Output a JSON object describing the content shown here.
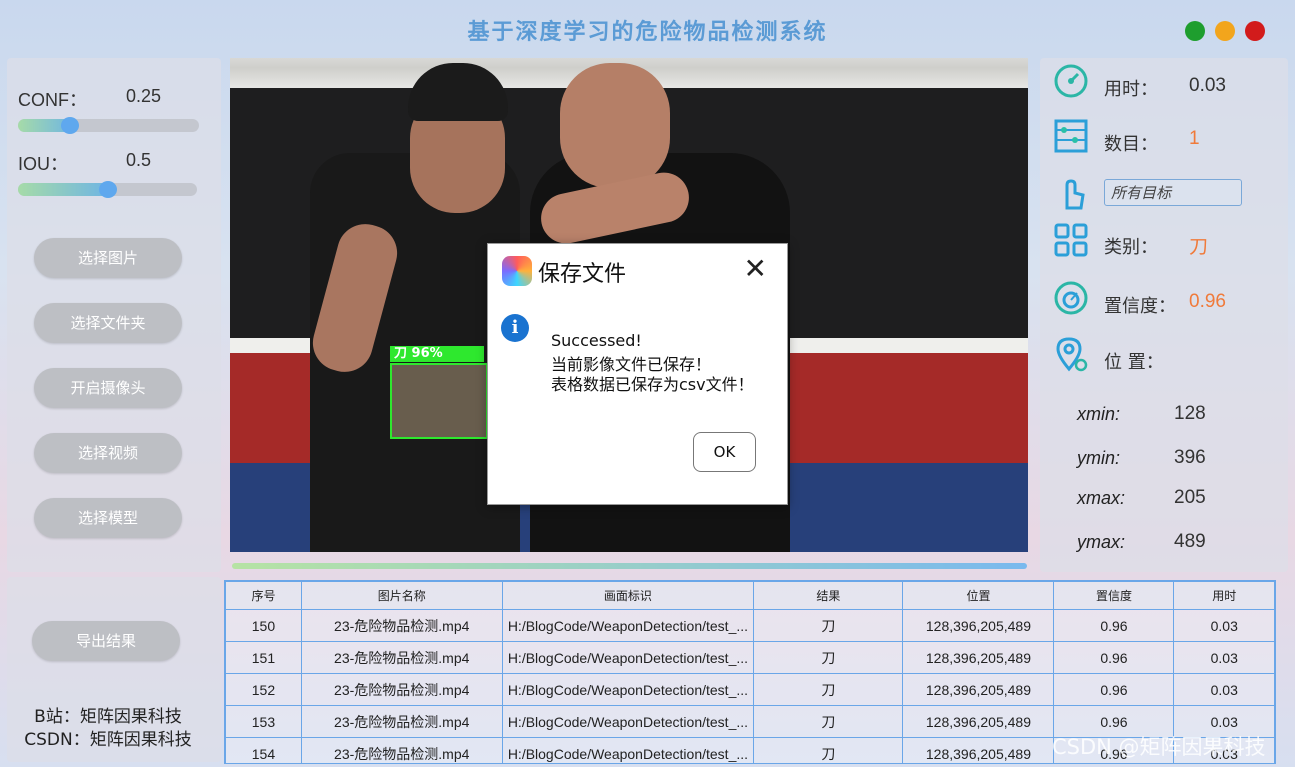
{
  "app": {
    "title": "基于深度学习的危险物品检测系统"
  },
  "window_controls": {
    "colors": [
      "#1e9e2e",
      "#f2a51c",
      "#d21b1b"
    ]
  },
  "controls": {
    "conf_label": "CONF：",
    "conf_value": "0.25",
    "conf_fraction": 0.25,
    "iou_label": "IOU：",
    "iou_value": "0.5",
    "iou_fraction": 0.5,
    "buttons": [
      "选择图片",
      "选择文件夹",
      "开启摄像头",
      "选择视频",
      "选择模型"
    ],
    "export_button": "导出结果",
    "credits": [
      "B站：矩阵因果科技",
      "CSDN：矩阵因果科技"
    ]
  },
  "video": {
    "detection_label": "刀  96%"
  },
  "dialog": {
    "title": "保存文件",
    "close": "✕",
    "info_icon": "i",
    "lines": [
      "Successed!",
      "当前影像文件已保存！",
      "表格数据已保存为csv文件！"
    ],
    "ok_label": "OK"
  },
  "stats": {
    "time_label": "用时：",
    "time_value": "0.03",
    "count_label": "数目：",
    "count_value": "1",
    "target_select": "所有目标",
    "class_label": "类别：",
    "class_value": "刀",
    "conf_label": "置信度：",
    "conf_value": "0.96",
    "position_label": "位 置：",
    "xmin_label": "xmin:",
    "xmin": "128",
    "ymin_label": "ymin:",
    "ymin": "396",
    "xmax_label": "xmax:",
    "xmax": "205",
    "ymax_label": "ymax:",
    "ymax": "489"
  },
  "table": {
    "headers": [
      "序号",
      "图片名称",
      "画面标识",
      "结果",
      "位置",
      "置信度",
      "用时"
    ],
    "rows": [
      [
        "150",
        "23-危险物品检测.mp4",
        "H:/BlogCode/WeaponDetection/test_...",
        "刀",
        "128,396,205,489",
        "0.96",
        "0.03"
      ],
      [
        "151",
        "23-危险物品检测.mp4",
        "H:/BlogCode/WeaponDetection/test_...",
        "刀",
        "128,396,205,489",
        "0.96",
        "0.03"
      ],
      [
        "152",
        "23-危险物品检测.mp4",
        "H:/BlogCode/WeaponDetection/test_...",
        "刀",
        "128,396,205,489",
        "0.96",
        "0.03"
      ],
      [
        "153",
        "23-危险物品检测.mp4",
        "H:/BlogCode/WeaponDetection/test_...",
        "刀",
        "128,396,205,489",
        "0.96",
        "0.03"
      ],
      [
        "154",
        "23-危险物品检测.mp4",
        "H:/BlogCode/WeaponDetection/test_...",
        "刀",
        "128,396,205,489",
        "0.96",
        "0.03"
      ]
    ]
  },
  "watermark": "CSDN @矩阵因果科技"
}
